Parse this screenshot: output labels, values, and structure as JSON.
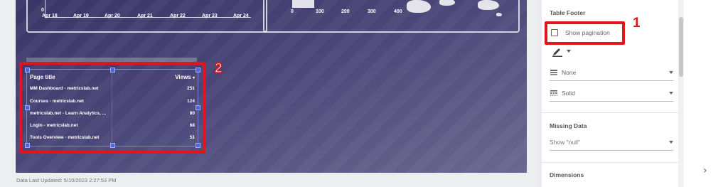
{
  "report": {
    "line_chart": {
      "y_zero": "0",
      "x_ticks": [
        "Apr 18",
        "Apr 19",
        "Apr 20",
        "Apr 21",
        "Apr 22",
        "Apr 23",
        "Apr 24"
      ]
    },
    "map_chart": {
      "x_ticks": [
        "0",
        "100",
        "200",
        "300",
        "400"
      ]
    },
    "table": {
      "header_title": "Page title",
      "header_views": "Views",
      "rows": [
        {
          "title": "MM Dashboard - metricslab.net",
          "views": "251"
        },
        {
          "title": "Courses - metricslab.net",
          "views": "124"
        },
        {
          "title": "metricslab.net - Learn Analytics, ...",
          "views": "80"
        },
        {
          "title": "Login - metricslab.net",
          "views": "68"
        },
        {
          "title": "Tools Overview - metricslab.net",
          "views": "51"
        }
      ]
    },
    "last_updated": "Data Last Updated: 5/10/2023 2:27:53 PM"
  },
  "annotations": {
    "one": "1",
    "two": "2",
    "color": "#e0151e"
  },
  "panel": {
    "table_footer_title": "Table Footer",
    "show_pagination_label": "Show pagination",
    "show_pagination_checked": false,
    "border_weight": "None",
    "border_style": "Solid",
    "missing_data_title": "Missing Data",
    "missing_data_value": "Show \"null\"",
    "dimensions_title": "Dimensions"
  },
  "icons": {
    "pen": "pen-icon",
    "lines": "line-weight-icon",
    "style": "line-style-icon",
    "chevron": "chevron-right-icon"
  }
}
